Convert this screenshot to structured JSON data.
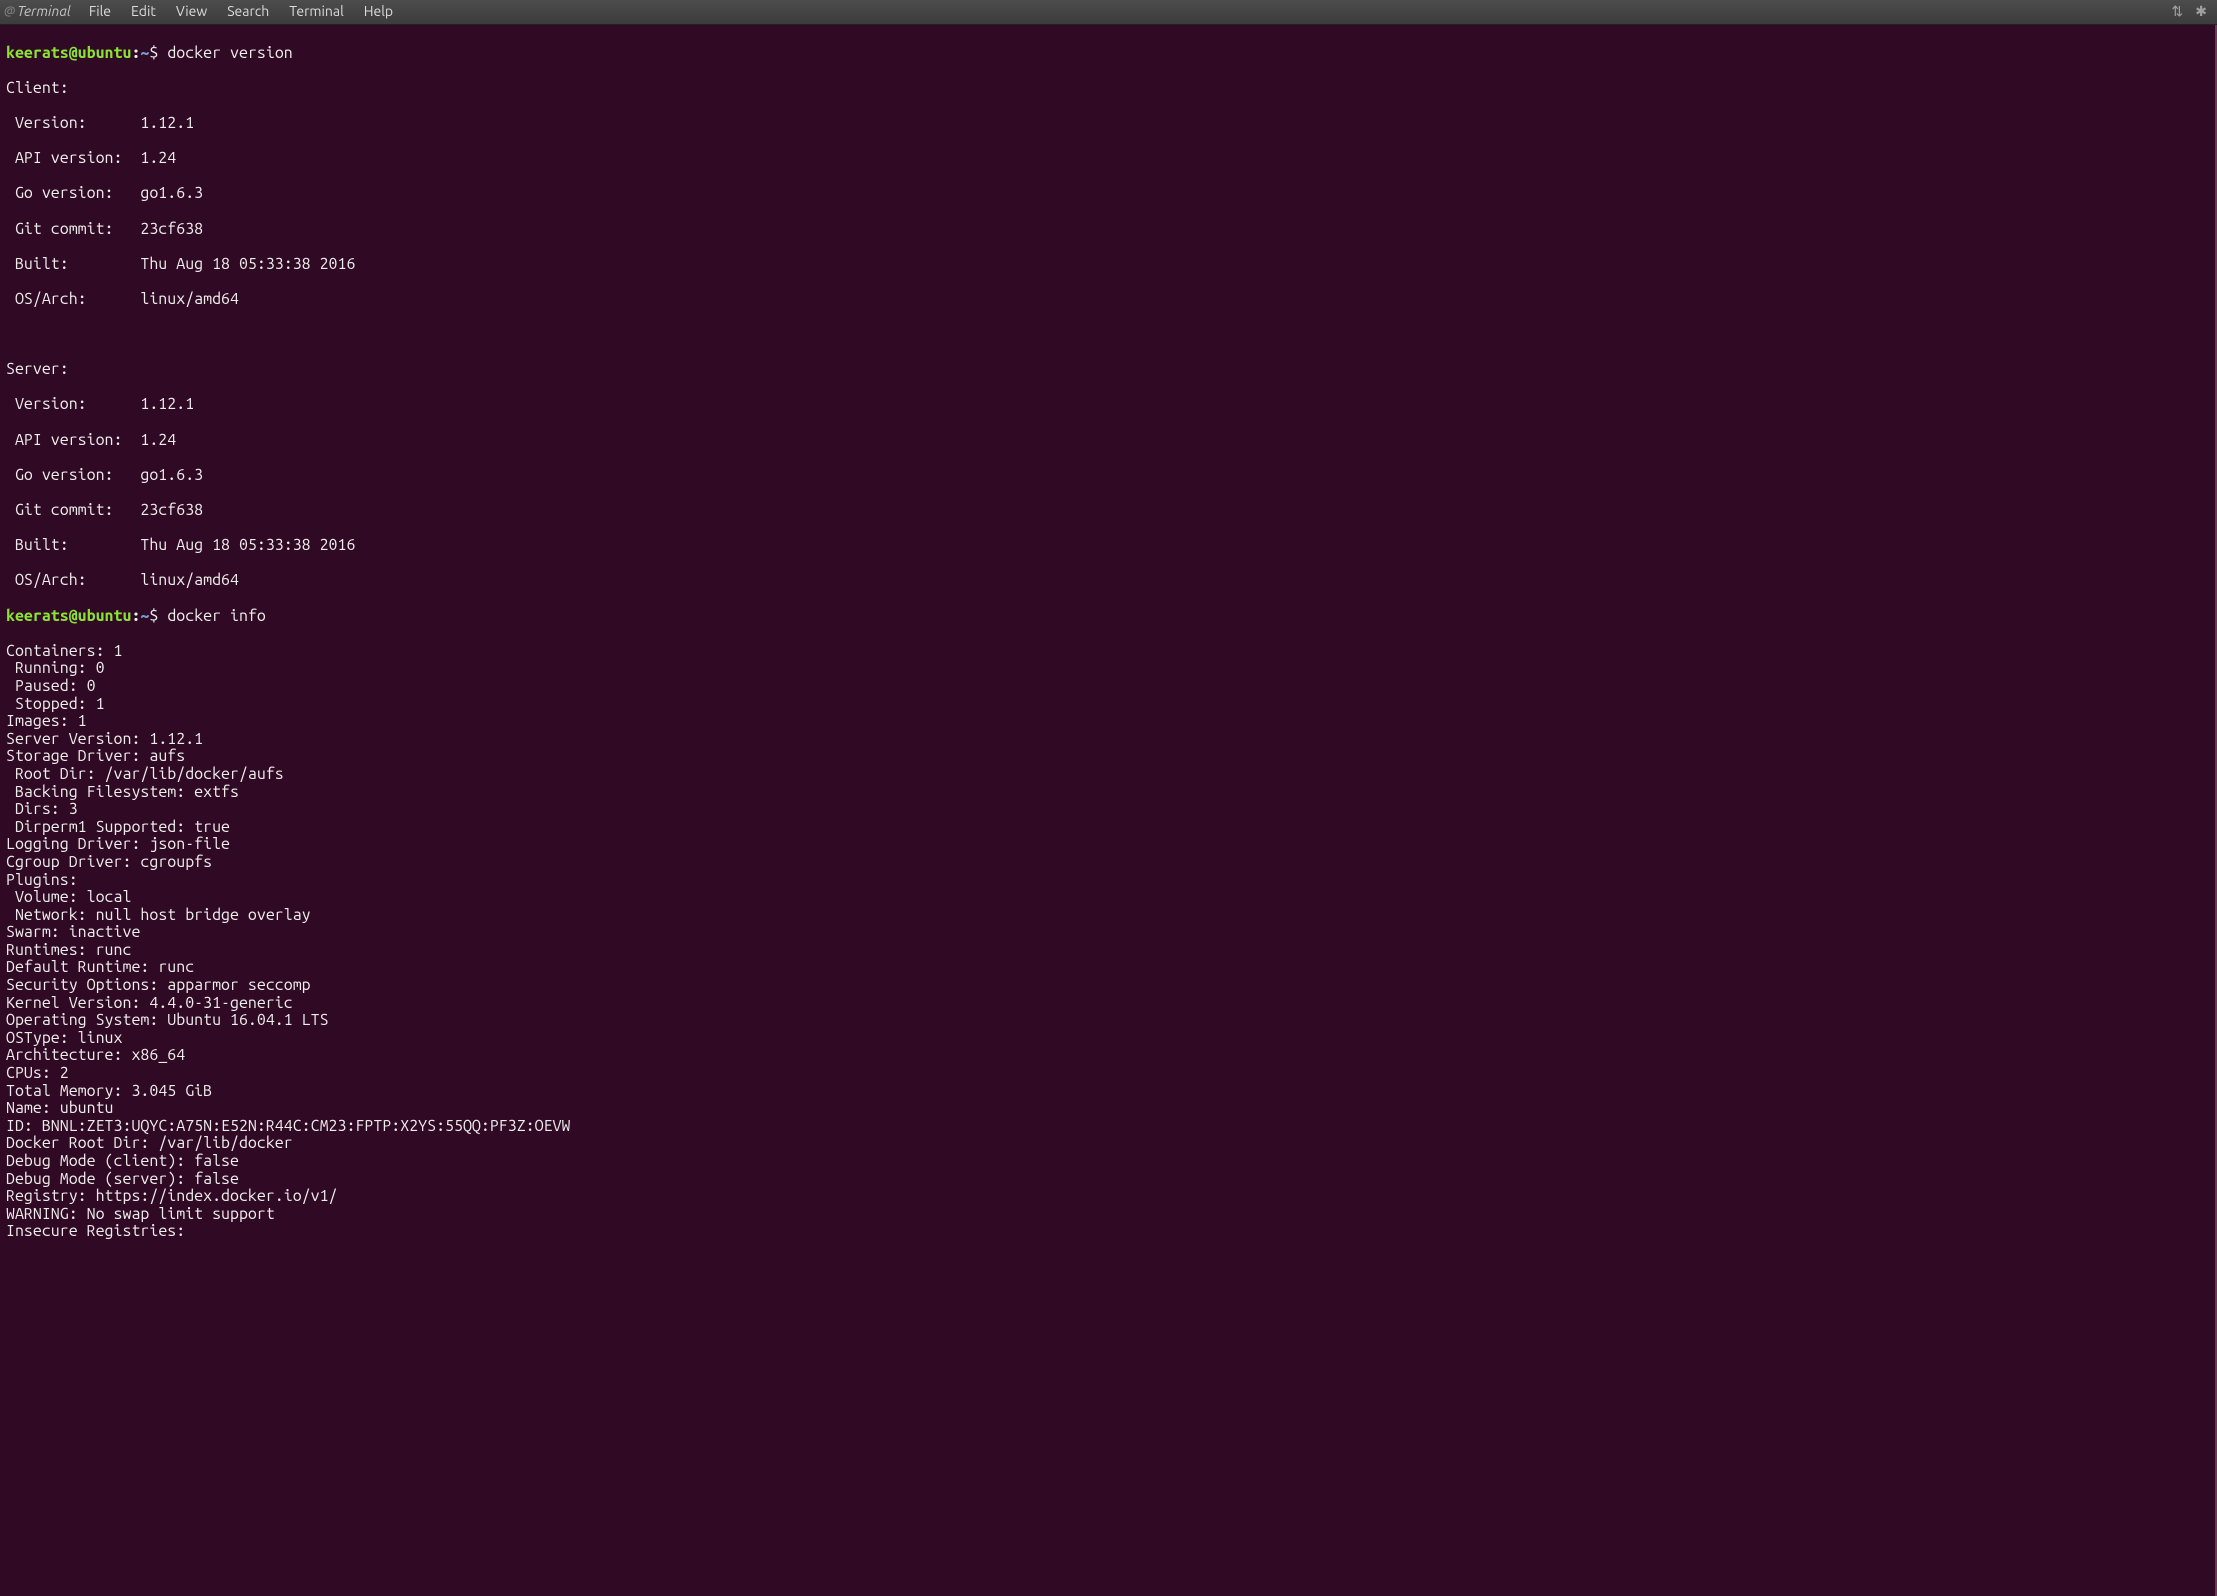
{
  "menubar": {
    "app_mark": "@",
    "title": "Terminal",
    "items": [
      "File",
      "Edit",
      "View",
      "Search",
      "Terminal",
      "Help"
    ],
    "indicators": {
      "net": "⇅",
      "bt": "✱"
    }
  },
  "prompt": {
    "user_host": "keerats@ubuntu",
    "colon": ":",
    "path": "~",
    "symbol": "$"
  },
  "cmd1": "docker version",
  "cmd2": "docker info",
  "client_header": "Client:",
  "server_header": "Server:",
  "kv_rows": {
    "version": {
      "label": " Version:",
      "value": "1.12.1"
    },
    "api": {
      "label": " API version:",
      "value": "1.24"
    },
    "go": {
      "label": " Go version:",
      "value": "go1.6.3"
    },
    "git": {
      "label": " Git commit:",
      "value": "23cf638"
    },
    "built": {
      "label": " Built:",
      "value": "Thu Aug 18 05:33:38 2016"
    },
    "osarch": {
      "label": " OS/Arch:",
      "value": "linux/amd64"
    }
  },
  "info_lines": [
    "Containers: 1",
    " Running: 0",
    " Paused: 0",
    " Stopped: 1",
    "Images: 1",
    "Server Version: 1.12.1",
    "Storage Driver: aufs",
    " Root Dir: /var/lib/docker/aufs",
    " Backing Filesystem: extfs",
    " Dirs: 3",
    " Dirperm1 Supported: true",
    "Logging Driver: json-file",
    "Cgroup Driver: cgroupfs",
    "Plugins:",
    " Volume: local",
    " Network: null host bridge overlay",
    "Swarm: inactive",
    "Runtimes: runc",
    "Default Runtime: runc",
    "Security Options: apparmor seccomp",
    "Kernel Version: 4.4.0-31-generic",
    "Operating System: Ubuntu 16.04.1 LTS",
    "OSType: linux",
    "Architecture: x86_64",
    "CPUs: 2",
    "Total Memory: 3.045 GiB",
    "Name: ubuntu",
    "ID: BNNL:ZET3:UQYC:A75N:E52N:R44C:CM23:FPTP:X2YS:55QQ:PF3Z:OEVW",
    "Docker Root Dir: /var/lib/docker",
    "Debug Mode (client): false",
    "Debug Mode (server): false",
    "Registry: https://index.docker.io/v1/",
    "WARNING: No swap limit support",
    "Insecure Registries:"
  ]
}
